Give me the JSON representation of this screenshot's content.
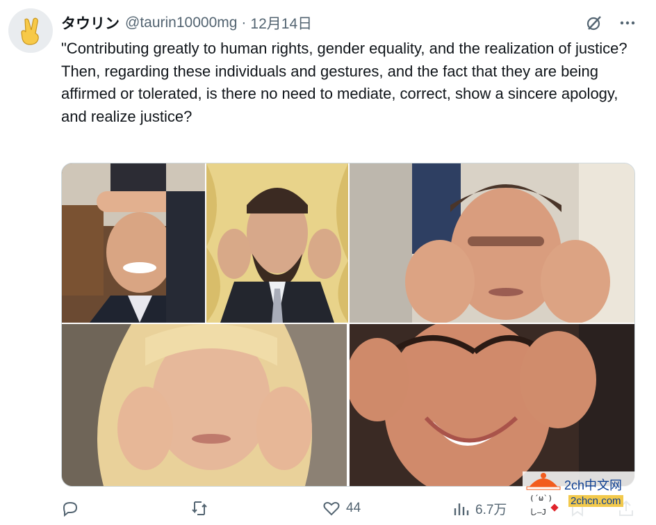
{
  "tweet": {
    "author_name": "タウリン",
    "author_handle": "@taurin10000mg",
    "separator": "·",
    "date": "12月14日",
    "text": "\"Contributing greatly to human rights, gender equality, and the realization of justice?\nThen, regarding these individuals and gestures, and the fact that they are being affirmed or tolerated, is there no need to mediate, correct, show a sincere apology, and realize justice?"
  },
  "header_icons": [
    "grok-icon",
    "more-icon"
  ],
  "media": {
    "images": [
      {
        "name": "photo-man-hand-on-head-grinning"
      },
      {
        "name": "photo-bearded-man-pulling-eyes"
      },
      {
        "name": "photo-man-pulling-eyes-window"
      },
      {
        "name": "photo-blonde-woman-pulling-eyes"
      },
      {
        "name": "photo-dark-haired-woman-pulling-eyes"
      }
    ]
  },
  "actions": {
    "replies": "",
    "retweets": "",
    "likes": "44",
    "views": "6.7万"
  },
  "watermark": {
    "line1": "2ch中文网",
    "line2": "2chcn.com"
  },
  "colors": {
    "text": "#0f1419",
    "secondary": "#536471",
    "border": "#cfd9de"
  }
}
